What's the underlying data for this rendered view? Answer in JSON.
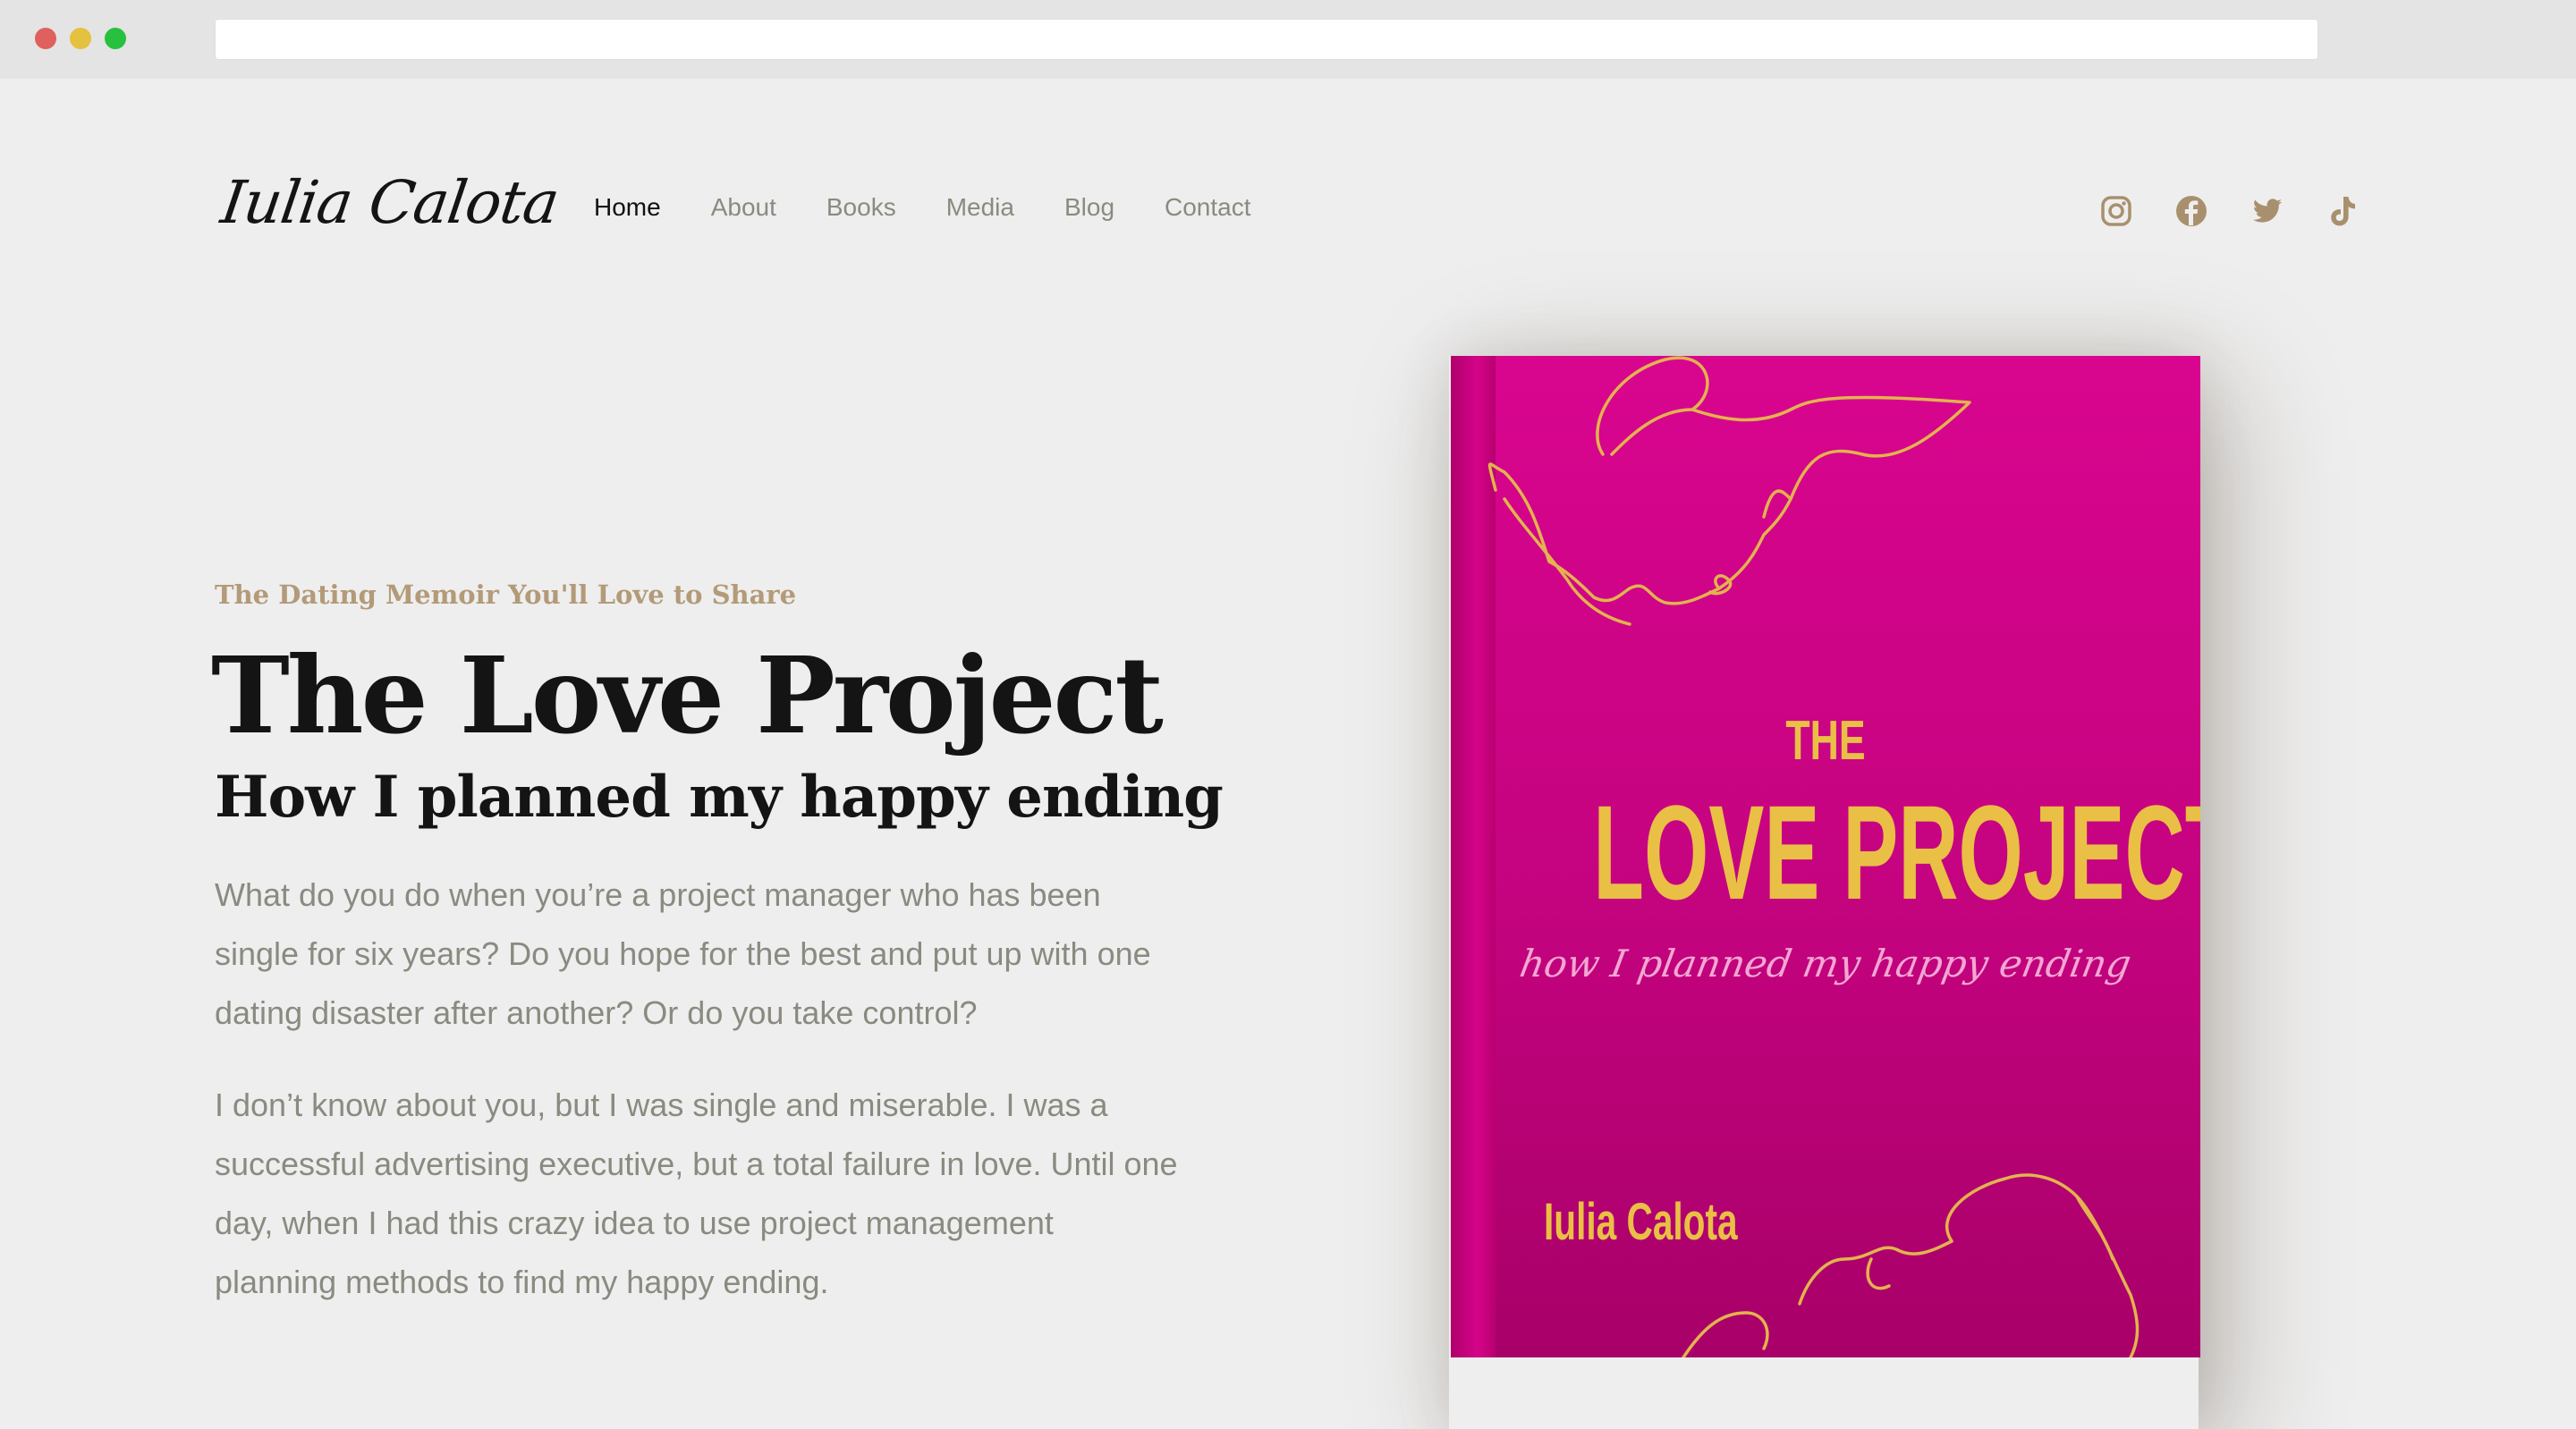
{
  "brand": {
    "logo_text": "Iulia Calota"
  },
  "nav": {
    "items": [
      {
        "label": "Home",
        "active": true
      },
      {
        "label": "About",
        "active": false
      },
      {
        "label": "Books",
        "active": false
      },
      {
        "label": "Media",
        "active": false
      },
      {
        "label": "Blog",
        "active": false
      },
      {
        "label": "Contact",
        "active": false
      }
    ]
  },
  "social": {
    "icons": [
      "instagram-icon",
      "facebook-icon",
      "twitter-icon",
      "tiktok-icon"
    ],
    "color": "#a8906e"
  },
  "hero": {
    "eyebrow": "The Dating Memoir You'll Love to Share",
    "title": "The Love Project",
    "subtitle": "How I planned my happy ending",
    "paragraph_1": "What do you do when you’re a project manager who has been single for six years? Do you hope for the best and put up with one dating disaster after another? Or do you take control?",
    "paragraph_2": "I don’t know about you, but I was single and miserable. I was a successful advertising executive, but a total failure in love. Until one day, when I had this crazy idea to use project management planning methods to find my happy ending."
  },
  "book_cover": {
    "the": "THE",
    "title": "LOVE PROJECT",
    "subtitle": "how I planned my happy ending",
    "author": "Iulia Calota",
    "cover_color": "#d1048a",
    "text_color": "#e9bf45"
  }
}
